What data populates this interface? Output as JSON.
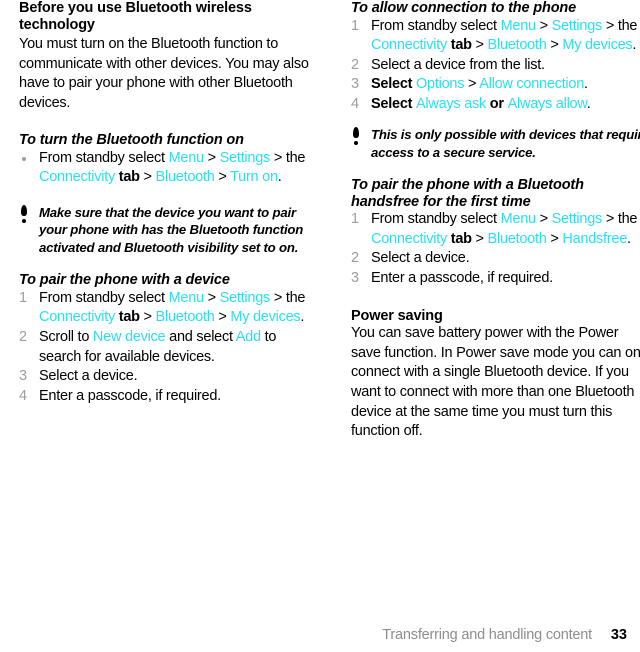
{
  "document": {
    "page_number": "33",
    "footer_title": "Transferring and handling content",
    "accent_color": "#2adff2",
    "marker_color": "#9d9d9d",
    "footer_color": "#8d8d8d"
  },
  "left_column": {
    "section_heading": "Before you use Bluetooth wireless technology",
    "intro_paragraph": "You must turn on the Bluetooth function to communicate with other devices. You may also have to pair your phone with other Bluetooth devices.",
    "task1": {
      "heading": "To turn the Bluetooth function on",
      "bullet": {
        "marker": "bullet-dot",
        "parts": [
          {
            "t": "From standby select ",
            "s": "plain"
          },
          {
            "t": "Menu",
            "s": "ui"
          },
          {
            "t": " > ",
            "s": "plain"
          },
          {
            "t": "Settings",
            "s": "ui"
          },
          {
            "t": " > the ",
            "s": "plain"
          },
          {
            "t": "Connectivity",
            "s": "ui"
          },
          {
            "t": " tab",
            "s": "bold"
          },
          {
            "t": " > ",
            "s": "plain"
          },
          {
            "t": "Bluetooth",
            "s": "ui"
          },
          {
            "t": " > ",
            "s": "plain"
          },
          {
            "t": "Turn on",
            "s": "ui"
          },
          {
            "t": ".",
            "s": "plain"
          }
        ]
      }
    },
    "note1": {
      "icon": "exclamation-icon",
      "text": "Make sure that the device you want to pair your phone with has the Bluetooth function activated and Bluetooth visibility set to on."
    },
    "task2": {
      "heading": "To pair the phone with a device",
      "steps": [
        {
          "marker": "1",
          "parts": [
            {
              "t": "From standby select ",
              "s": "plain"
            },
            {
              "t": "Menu",
              "s": "ui"
            },
            {
              "t": " > ",
              "s": "plain"
            },
            {
              "t": "Settings",
              "s": "ui"
            },
            {
              "t": " > the ",
              "s": "plain"
            },
            {
              "t": "Connectivity",
              "s": "ui"
            },
            {
              "t": " tab",
              "s": "bold"
            },
            {
              "t": " > ",
              "s": "plain"
            },
            {
              "t": "Bluetooth",
              "s": "ui"
            },
            {
              "t": " > ",
              "s": "plain"
            },
            {
              "t": "My devices",
              "s": "ui"
            },
            {
              "t": ".",
              "s": "plain"
            }
          ]
        },
        {
          "marker": "2",
          "parts": [
            {
              "t": "Scroll to ",
              "s": "plain"
            },
            {
              "t": "New device",
              "s": "ui"
            },
            {
              "t": " and select ",
              "s": "plain"
            },
            {
              "t": "Add",
              "s": "ui"
            },
            {
              "t": " to search for available devices.",
              "s": "plain"
            }
          ]
        },
        {
          "marker": "3",
          "parts": [
            {
              "t": "Select a device.",
              "s": "plain"
            }
          ]
        },
        {
          "marker": "4",
          "parts": [
            {
              "t": "Enter a passcode, if required.",
              "s": "plain"
            }
          ]
        }
      ]
    }
  },
  "right_column": {
    "task1": {
      "heading": "To allow connection to the phone",
      "steps": [
        {
          "marker": "1",
          "parts": [
            {
              "t": "From standby select ",
              "s": "plain"
            },
            {
              "t": "Menu",
              "s": "ui"
            },
            {
              "t": " > ",
              "s": "plain"
            },
            {
              "t": "Settings",
              "s": "ui"
            },
            {
              "t": " > the ",
              "s": "plain"
            },
            {
              "t": "Connectivity",
              "s": "ui"
            },
            {
              "t": " tab",
              "s": "bold"
            },
            {
              "t": " > ",
              "s": "plain"
            },
            {
              "t": "Bluetooth",
              "s": "ui"
            },
            {
              "t": " > ",
              "s": "plain"
            },
            {
              "t": "My devices",
              "s": "ui"
            },
            {
              "t": ".",
              "s": "plain"
            }
          ]
        },
        {
          "marker": "2",
          "parts": [
            {
              "t": "Select a device from the list.",
              "s": "plain"
            }
          ]
        },
        {
          "marker": "3",
          "parts": [
            {
              "t": "Select ",
              "s": "bold"
            },
            {
              "t": "Options",
              "s": "ui"
            },
            {
              "t": " > ",
              "s": "plain"
            },
            {
              "t": "Allow connection",
              "s": "ui"
            },
            {
              "t": ".",
              "s": "plain"
            }
          ]
        },
        {
          "marker": "4",
          "parts": [
            {
              "t": "Select ",
              "s": "bold"
            },
            {
              "t": "Always ask",
              "s": "ui"
            },
            {
              "t": " or ",
              "s": "bold"
            },
            {
              "t": "Always allow",
              "s": "ui"
            },
            {
              "t": ".",
              "s": "plain"
            }
          ]
        }
      ]
    },
    "note1": {
      "icon": "exclamation-icon",
      "text": "This is only possible with devices that require access to a secure service."
    },
    "task2": {
      "heading": "To pair the phone with a Bluetooth handsfree for the first time",
      "steps": [
        {
          "marker": "1",
          "parts": [
            {
              "t": "From standby select ",
              "s": "plain"
            },
            {
              "t": "Menu",
              "s": "ui"
            },
            {
              "t": " > ",
              "s": "plain"
            },
            {
              "t": "Settings",
              "s": "ui"
            },
            {
              "t": " > the ",
              "s": "plain"
            },
            {
              "t": "Connectivity",
              "s": "ui"
            },
            {
              "t": " tab",
              "s": "bold"
            },
            {
              "t": " > ",
              "s": "plain"
            },
            {
              "t": "Bluetooth",
              "s": "ui"
            },
            {
              "t": " > ",
              "s": "plain"
            },
            {
              "t": "Handsfree",
              "s": "ui"
            },
            {
              "t": ".",
              "s": "plain"
            }
          ]
        },
        {
          "marker": "2",
          "parts": [
            {
              "t": "Select a device.",
              "s": "plain"
            }
          ]
        },
        {
          "marker": "3",
          "parts": [
            {
              "t": "Enter a passcode, if required.",
              "s": "plain"
            }
          ]
        }
      ]
    },
    "section2": {
      "heading": "Power saving",
      "paragraph": "You can save battery power with the Power save function. In Power save mode you can only connect with a single Bluetooth device. If you want to connect with more than one Bluetooth device at the same time you must turn this function off."
    }
  }
}
